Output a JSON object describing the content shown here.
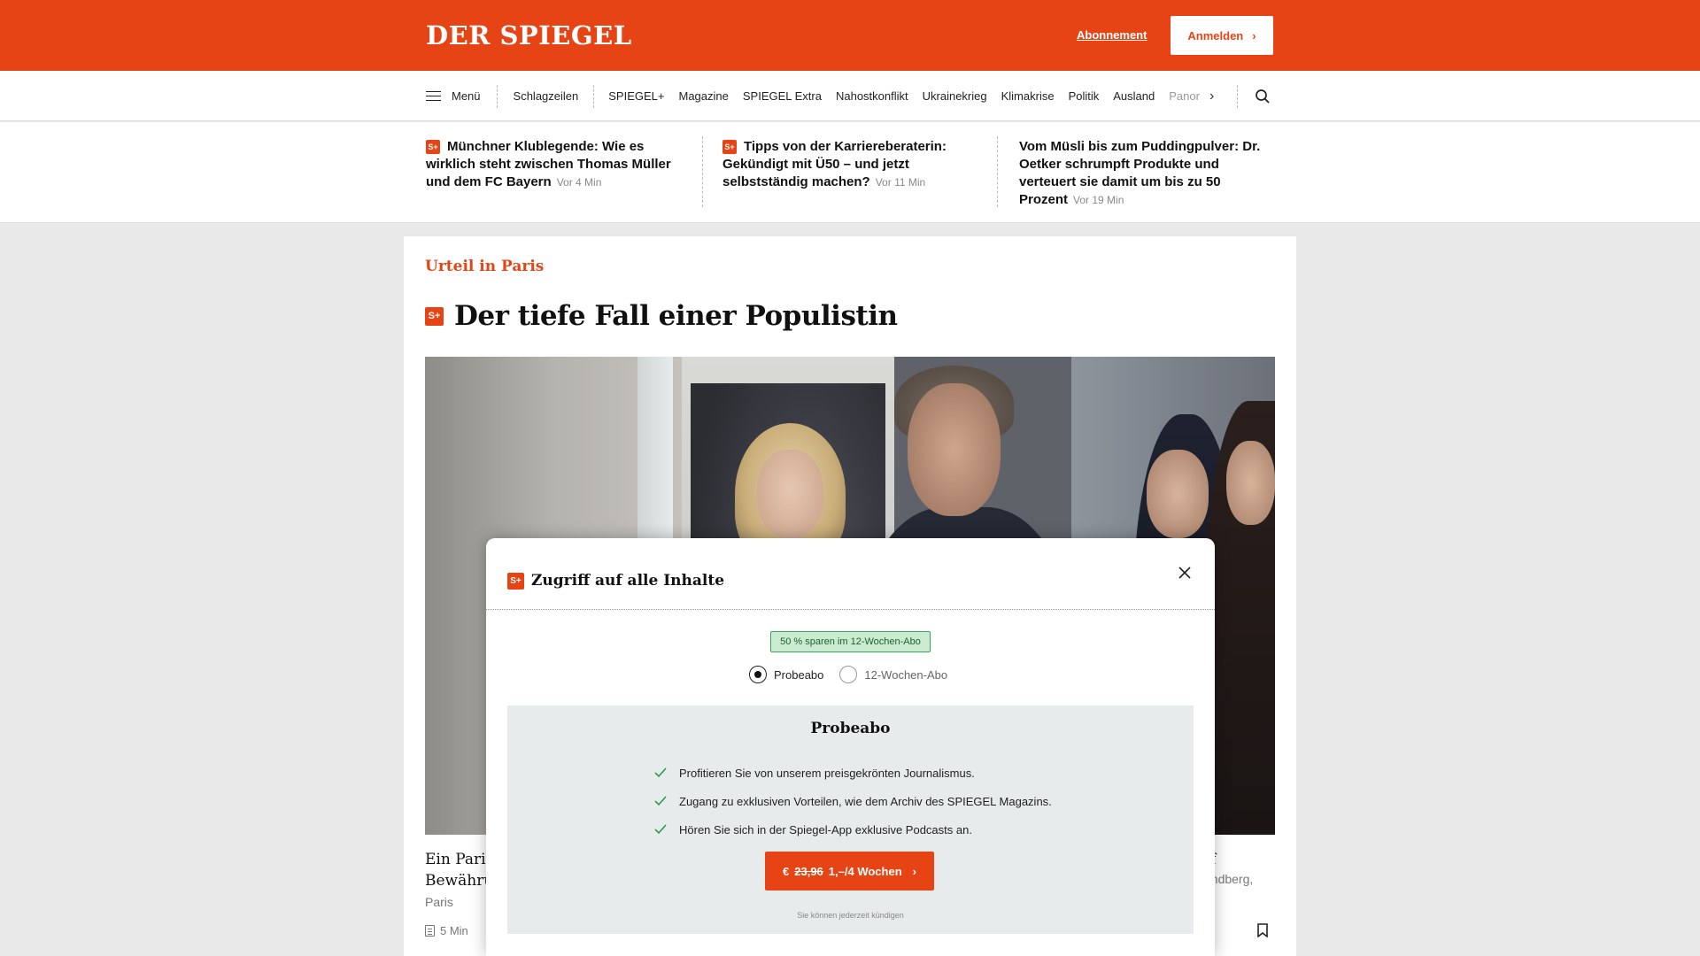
{
  "header": {
    "logo": "DER SPIEGEL",
    "abo_link": "Abonnement",
    "login_label": "Anmelden",
    "accent_color": "#e64415"
  },
  "nav": {
    "menu_label": "Menü",
    "items": [
      "Schlagzeilen",
      "SPIEGEL+",
      "Magazine",
      "SPIEGEL Extra",
      "Nahostkonflikt",
      "Ukrainekrieg",
      "Klimakrise",
      "Politik",
      "Ausland",
      "Panor"
    ],
    "icons": [
      "hamburger-icon",
      "chevron-right-icon",
      "search-icon"
    ]
  },
  "ticker": [
    {
      "plus": true,
      "title": "Münchner Klublegende: Wie es wirklich steht zwischen Thomas Müller und dem FC Bayern",
      "time": "Vor 4 Min"
    },
    {
      "plus": true,
      "title": "Tipps von der Karriereberaterin: Gekündigt mit Ü50 – und jetzt selbstständig machen?",
      "time": "Vor 11 Min"
    },
    {
      "plus": false,
      "title": "Vom Müsli bis zum Puddingpulver: Dr. Oetker schrumpft Produkte und verteuert sie damit um bis zu 50 Prozent",
      "time": "Vor 19 Min"
    }
  ],
  "splus_badge": "S+",
  "article": {
    "kicker": "Urteil in Paris",
    "title": "Der tiefe Fall einer Populistin",
    "teaser_left_1": "Ein Paris",
    "teaser_left_2": "Bewähru",
    "teaser_right": "uf",
    "location": "Paris",
    "location_right": "andberg,",
    "read_time": "5 Min"
  },
  "modal": {
    "title": "Zugriff auf alle Inhalte",
    "save_badge": "50 % sparen im 12-Wochen-Abo",
    "options": [
      {
        "label": "Probeabo",
        "selected": true
      },
      {
        "label": "12-Wochen-Abo",
        "selected": false
      }
    ],
    "plan": {
      "title": "Probeabo",
      "benefits": [
        "Profitieren Sie von unserem preisgekrönten Journalismus.",
        "Zugang zu exklusiven Vorteilen, wie dem Archiv des SPIEGEL Magazins.",
        "Hören Sie sich in der Spiegel-App exklusive Podcasts an."
      ],
      "cta_currency": "€",
      "cta_old_price": "23,96",
      "cta_new_price": "1,–/4 Wochen",
      "cancel_note": "Sie können jederzeit kündigen"
    }
  }
}
